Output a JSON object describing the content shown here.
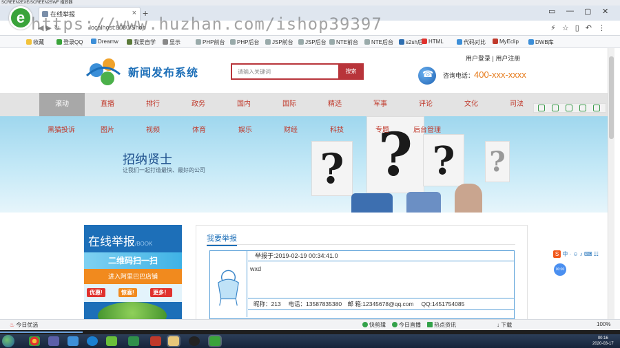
{
  "player": {
    "title": "SCREEN2EXE/SCREEN2SWF 播放器"
  },
  "browser": {
    "tab_title": "在线举报",
    "url_partial": "localhost:8080/Shop",
    "watermark": "https://www.huzhan.com/ishop39397",
    "bookmarks": [
      "收藏",
      "登录QQ",
      "Dreamw",
      "我爱自学",
      "显示",
      "PHP前台",
      "PHP后台",
      "JSP前台",
      "JSP后台",
      "NTE前台",
      "NTE后台",
      "s2sh后",
      "HTML",
      "代码对比",
      "MyEclip",
      "DWB库"
    ]
  },
  "site": {
    "name": "新闻发布系统",
    "top_links": "用户登录 | 用户注册",
    "search_placeholder": "请输入关键词",
    "search_button": "搜索",
    "consult_label": "咨询电话：",
    "phone": "400-xxx-xxxx"
  },
  "nav": [
    "滚动",
    "直播",
    "排行",
    "政务",
    "国内",
    "国际",
    "精选",
    "军事",
    "评论",
    "文化",
    "司法"
  ],
  "subnav": [
    "黑猫投诉",
    "图片",
    "视频",
    "体育",
    "娱乐",
    "财经",
    "科技",
    "专题",
    "后台管理"
  ],
  "banner": {
    "title": "招纳贤士",
    "subtitle": "让我们一起打造最快、最好的公司"
  },
  "report": {
    "box_title": "在线举报",
    "box_title_en": "/BOOK",
    "stripe1": "二维码扫一扫",
    "stripe2": "进入阿里巴巴店铺",
    "badges": [
      "优惠!",
      "惊喜!",
      "更多！"
    ]
  },
  "content": {
    "section_title": "我要举报",
    "message": {
      "head": "举报于:2019-02-19 00:34:41.0",
      "body": "wxd",
      "footer": "昵称：213　 电话：13587835380　邮 箱:12345678@qq.com　 QQ:1451754085"
    }
  },
  "statusbar": {
    "left": "今日优选",
    "items": [
      "快剪辑",
      "今日直播",
      "热点资讯",
      "下载",
      "100%"
    ]
  },
  "ime": {
    "label": "中",
    "bubble": "00:00"
  },
  "clock": {
    "time": "00:16",
    "date": "2020-03-17"
  }
}
